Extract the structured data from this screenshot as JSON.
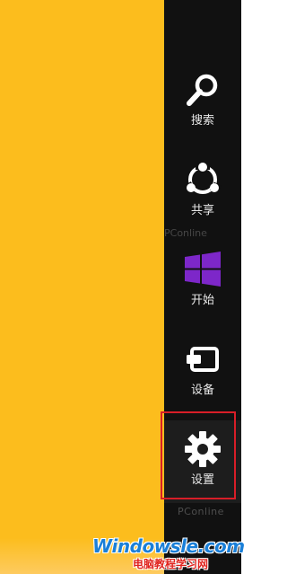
{
  "desktop": {
    "background_color": "#fcbd1d"
  },
  "charms_bar": {
    "background_color": "#111111",
    "highlight_color": "#d81e28",
    "items": [
      {
        "label": "搜索",
        "icon": "search-icon"
      },
      {
        "label": "共享",
        "icon": "share-icon"
      },
      {
        "label": "开始",
        "icon": "windows-start-icon",
        "icon_color": "#7d27c9"
      },
      {
        "label": "设备",
        "icon": "devices-icon"
      },
      {
        "label": "设置",
        "icon": "gear-icon",
        "selected": true
      }
    ]
  },
  "watermark": {
    "site": "PConline",
    "brand": "Windowsle.com",
    "subtitle": "电脑教程学习网"
  }
}
